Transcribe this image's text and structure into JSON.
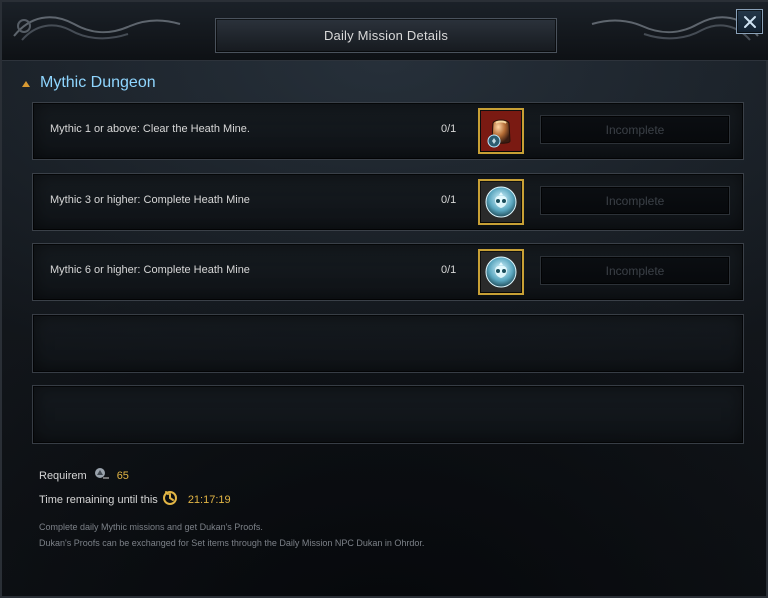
{
  "window": {
    "title": "Daily Mission Details",
    "close_icon": "close-icon"
  },
  "section": {
    "title": "Mythic Dungeon",
    "bullet_icon": "triangle-up-icon"
  },
  "missions": [
    {
      "text": "Mythic 1 or above: Clear the Heath Mine.",
      "progress": "0/1",
      "icon": "reward-bag-icon",
      "status": "Incomplete"
    },
    {
      "text": "Mythic 3 or higher: Complete Heath Mine",
      "progress": "0/1",
      "icon": "mythic-emblem-icon",
      "status": "Incomplete"
    },
    {
      "text": "Mythic 6 or higher: Complete Heath Mine",
      "progress": "0/1",
      "icon": "mythic-emblem-icon",
      "status": "Incomplete"
    }
  ],
  "requirements": {
    "label": "Requirem",
    "level_icon": "level-icon",
    "level_value": "65"
  },
  "time_remaining": {
    "label": "Time remaining until this",
    "timer_icon": "timer-icon",
    "value": "21:17:19"
  },
  "description": {
    "line1": "Complete daily Mythic missions and get Dukan's Proofs.",
    "line2": "Dukan's Proofs can be exchanged for Set items through the Daily Mission NPC Dukan in Ohrdor."
  },
  "colors": {
    "accent_blue": "#8fd6ff",
    "accent_gold": "#e2b545",
    "frame_gold": "#c8a035"
  }
}
